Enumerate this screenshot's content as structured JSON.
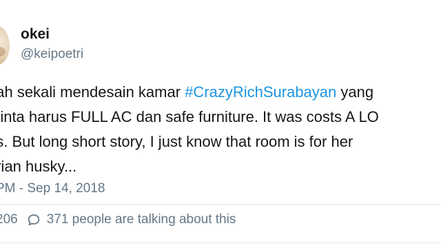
{
  "user": {
    "display_name": "okei",
    "handle": "@keipoetri"
  },
  "tweet": {
    "line1_before": "nah sekali mendesain kamar ",
    "hashtag": "#CrazyRichSurabayan",
    "line1_after": " yang",
    "line2": "minta harus FULL AC dan safe furniture. It was costs A LO",
    "line3": "ds. But long short story, I just know that room is for her",
    "line4": "erian husky..."
  },
  "timestamp": "PM - Sep 14, 2018",
  "actions": {
    "like_count": "206",
    "talking_label": "371 people are talking about this"
  },
  "icons": {
    "reply": "speech-bubble-icon",
    "avatar": "avatar"
  },
  "colors": {
    "hashtag": "#1b95e0",
    "secondary_text": "#657786",
    "primary_text": "#14171a",
    "divider": "#e1e8ed"
  }
}
